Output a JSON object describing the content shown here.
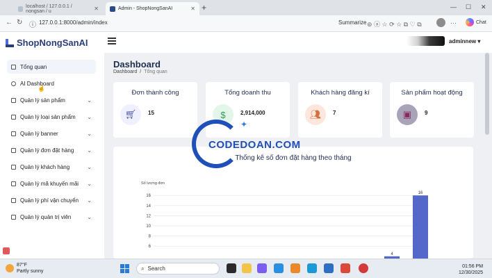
{
  "browser": {
    "tabs": [
      {
        "label": "localhost / 127.0.0.1 / nongsan / u"
      },
      {
        "label": "Admin - ShopNongSanAI"
      }
    ],
    "new_tab": "+",
    "url": "127.0.0.1:8000/admin/index",
    "summarize": "Summarize",
    "chat": "Chat"
  },
  "header": {
    "logo": "ShopNongSanAI",
    "user": "adminnew ▾"
  },
  "sidebar": {
    "items": [
      {
        "label": "Tổng quan"
      },
      {
        "label": "AI Dashboard"
      },
      {
        "label": "Quản lý sản phẩm"
      },
      {
        "label": "Quản lý loại sản phẩm"
      },
      {
        "label": "Quản lý banner"
      },
      {
        "label": "Quản lý đơn đặt hàng"
      },
      {
        "label": "Quản lý khách hàng"
      },
      {
        "label": "Quản lý mã khuyến mãi"
      },
      {
        "label": "Quản lý phí vận chuyển"
      },
      {
        "label": "Quản lý quản trị viên"
      }
    ]
  },
  "page": {
    "title": "Dashboard",
    "breadcrumb": {
      "home": "Dashboard",
      "sep": "/",
      "current": "Tổng quan"
    }
  },
  "cards": [
    {
      "title": "Đơn thành công",
      "value": "15",
      "icon": "cart-icon",
      "color": "#eef0ff"
    },
    {
      "title": "Tổng doanh thu",
      "value": "2,914,000",
      "icon": "dollar-icon",
      "color": "#e3f6ea"
    },
    {
      "title": "Khách hàng đăng kí",
      "value": "7",
      "icon": "users-icon",
      "color": "#fde7dc"
    },
    {
      "title": "Sản phẩm hoạt động",
      "value": "9",
      "icon": "box-icon",
      "color": "#e7e4ef"
    }
  ],
  "chart": {
    "title": "Thống kê số đơn đặt hàng theo tháng",
    "ylabel": "Số lượng đơn"
  },
  "chart_data": {
    "type": "bar",
    "title": "Thống kê số đơn đặt hàng theo tháng",
    "ylabel": "Số lượng đơn",
    "yticks": [
      16,
      14,
      12,
      10,
      8,
      6
    ],
    "ylim": [
      0,
      16
    ],
    "series": [
      {
        "values": [
          4,
          16
        ]
      }
    ],
    "data_labels": [
      "4",
      "16"
    ],
    "bar_color": "#5468c9"
  },
  "watermark": {
    "text": "CODEDOAN.COM"
  },
  "taskbar": {
    "temp": "87°F",
    "weather": "Partly sunny",
    "search": "Search",
    "time": "01:56 PM",
    "date": "12/30/2025"
  }
}
